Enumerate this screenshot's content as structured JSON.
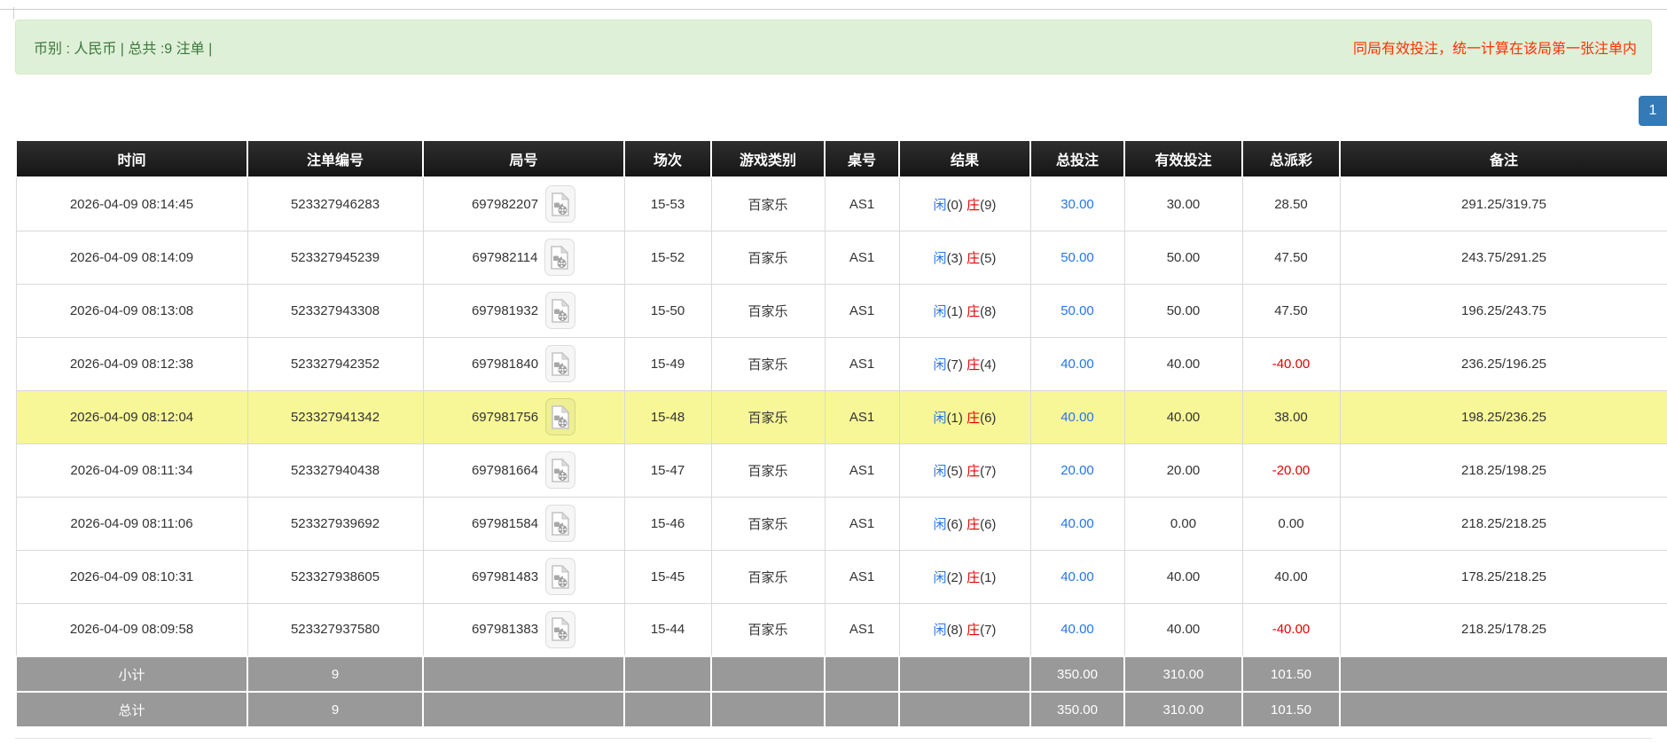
{
  "summary_bar": {
    "left_text": "币别 : 人民币 | 总共 :9 注单 |",
    "right_notice": "同局有效投注，统一计算在该局第一张注单内"
  },
  "pagination": {
    "current": "1"
  },
  "table": {
    "headers": [
      "时间",
      "注单编号",
      "局号",
      "场次",
      "游戏类别",
      "桌号",
      "结果",
      "总投注",
      "有效投注",
      "总派彩",
      "备注"
    ],
    "rows": [
      {
        "time": "2026-04-09 08:14:45",
        "bet_id": "523327946283",
        "round_id": "697982207",
        "session": "15-53",
        "game": "百家乐",
        "table_no": "AS1",
        "result": {
          "player_label": "闲",
          "player_score": "(0)",
          "banker_label": "庄",
          "banker_score": "(9)"
        },
        "total_bet": "30.00",
        "valid_bet": "30.00",
        "payout": "28.50",
        "note": "291.25/319.75",
        "highlighted": false
      },
      {
        "time": "2026-04-09 08:14:09",
        "bet_id": "523327945239",
        "round_id": "697982114",
        "session": "15-52",
        "game": "百家乐",
        "table_no": "AS1",
        "result": {
          "player_label": "闲",
          "player_score": "(3)",
          "banker_label": "庄",
          "banker_score": "(5)"
        },
        "total_bet": "50.00",
        "valid_bet": "50.00",
        "payout": "47.50",
        "note": "243.75/291.25",
        "highlighted": false
      },
      {
        "time": "2026-04-09 08:13:08",
        "bet_id": "523327943308",
        "round_id": "697981932",
        "session": "15-50",
        "game": "百家乐",
        "table_no": "AS1",
        "result": {
          "player_label": "闲",
          "player_score": "(1)",
          "banker_label": "庄",
          "banker_score": "(8)"
        },
        "total_bet": "50.00",
        "valid_bet": "50.00",
        "payout": "47.50",
        "note": "196.25/243.75",
        "highlighted": false
      },
      {
        "time": "2026-04-09 08:12:38",
        "bet_id": "523327942352",
        "round_id": "697981840",
        "session": "15-49",
        "game": "百家乐",
        "table_no": "AS1",
        "result": {
          "player_label": "闲",
          "player_score": "(7)",
          "banker_label": "庄",
          "banker_score": "(4)"
        },
        "total_bet": "40.00",
        "valid_bet": "40.00",
        "payout": "-40.00",
        "note": "236.25/196.25",
        "highlighted": false
      },
      {
        "time": "2026-04-09 08:12:04",
        "bet_id": "523327941342",
        "round_id": "697981756",
        "session": "15-48",
        "game": "百家乐",
        "table_no": "AS1",
        "result": {
          "player_label": "闲",
          "player_score": "(1)",
          "banker_label": "庄",
          "banker_score": "(6)"
        },
        "total_bet": "40.00",
        "valid_bet": "40.00",
        "payout": "38.00",
        "note": "198.25/236.25",
        "highlighted": true
      },
      {
        "time": "2026-04-09 08:11:34",
        "bet_id": "523327940438",
        "round_id": "697981664",
        "session": "15-47",
        "game": "百家乐",
        "table_no": "AS1",
        "result": {
          "player_label": "闲",
          "player_score": "(5)",
          "banker_label": "庄",
          "banker_score": "(7)"
        },
        "total_bet": "20.00",
        "valid_bet": "20.00",
        "payout": "-20.00",
        "note": "218.25/198.25",
        "highlighted": false
      },
      {
        "time": "2026-04-09 08:11:06",
        "bet_id": "523327939692",
        "round_id": "697981584",
        "session": "15-46",
        "game": "百家乐",
        "table_no": "AS1",
        "result": {
          "player_label": "闲",
          "player_score": "(6)",
          "banker_label": "庄",
          "banker_score": "(6)"
        },
        "total_bet": "40.00",
        "valid_bet": "0.00",
        "payout": "0.00",
        "note": "218.25/218.25",
        "highlighted": false
      },
      {
        "time": "2026-04-09 08:10:31",
        "bet_id": "523327938605",
        "round_id": "697981483",
        "session": "15-45",
        "game": "百家乐",
        "table_no": "AS1",
        "result": {
          "player_label": "闲",
          "player_score": "(2)",
          "banker_label": "庄",
          "banker_score": "(1)"
        },
        "total_bet": "40.00",
        "valid_bet": "40.00",
        "payout": "40.00",
        "note": "178.25/218.25",
        "highlighted": false
      },
      {
        "time": "2026-04-09 08:09:58",
        "bet_id": "523327937580",
        "round_id": "697981383",
        "session": "15-44",
        "game": "百家乐",
        "table_no": "AS1",
        "result": {
          "player_label": "闲",
          "player_score": "(8)",
          "banker_label": "庄",
          "banker_score": "(7)"
        },
        "total_bet": "40.00",
        "valid_bet": "40.00",
        "payout": "-40.00",
        "note": "218.25/178.25",
        "highlighted": false
      }
    ],
    "subtotal": {
      "label": "小计",
      "count": "9",
      "total_bet": "350.00",
      "valid_bet": "310.00",
      "payout": "101.50"
    },
    "total": {
      "label": "总计",
      "count": "9",
      "total_bet": "350.00",
      "valid_bet": "310.00",
      "payout": "101.50"
    }
  },
  "colors": {
    "success_bg": "#dff0d8",
    "success_border": "#d6e9c6",
    "success_text": "#3c763d",
    "notice_red": "#ff3000",
    "accent_blue": "#2575e8",
    "result_red": "#e60000",
    "highlight_yellow": "#f7f798",
    "footer_grey": "#999999",
    "pagination_blue": "#337ab7"
  }
}
